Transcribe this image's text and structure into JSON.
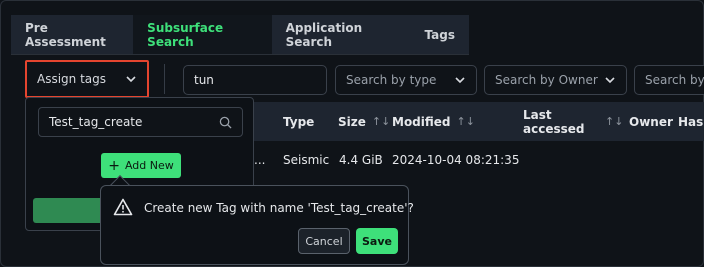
{
  "tabs": [
    {
      "label": "Pre Assessment",
      "active": false
    },
    {
      "label": "Subsurface Search",
      "active": true
    },
    {
      "label": "Application Search",
      "active": false
    },
    {
      "label": "Tags",
      "active": false
    }
  ],
  "filters": {
    "assign_tags_label": "Assign tags",
    "search_value": "tun",
    "type_placeholder": "Search by type",
    "owner_placeholder": "Search by Owner",
    "extra_placeholder": "Search by l"
  },
  "table": {
    "columns": {
      "type": "Type",
      "size": "Size",
      "modified": "Modified",
      "last_accessed": "Last accessed",
      "owner": "Owner",
      "hash": "Hash"
    },
    "sort_glyph": "↑↓",
    "row": {
      "name_trunc": "...",
      "type": "Seismic",
      "size": "4.4 GiB",
      "modified": "2024-10-04 08:21:35"
    }
  },
  "tag_dropdown": {
    "search_value": "Test_tag_create",
    "add_new_label": "Add New"
  },
  "confirm_popup": {
    "message": "Create new Tag with name 'Test_tag_create'?",
    "cancel_label": "Cancel",
    "save_label": "Save"
  },
  "colors": {
    "accent_green": "#3ee07a",
    "highlight_red": "#e5452f",
    "background": "#0f1318",
    "header_bg": "#1e2530"
  }
}
